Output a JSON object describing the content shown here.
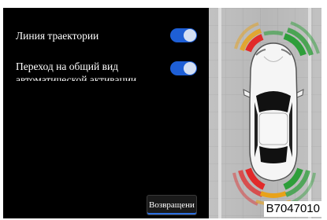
{
  "settings": {
    "trajectory_label": "Линия траектории",
    "trajectory_on": true,
    "overview_label_line1": "Переход на общий вид",
    "overview_label_line2": "автоматической активации",
    "overview_on": true,
    "back_label": "Возвращени"
  },
  "colors": {
    "toggle_on": "#1e5fd6",
    "sensor_red": "#e12a2a",
    "sensor_yellow": "#e8a21a",
    "sensor_green": "#2e9e3a"
  },
  "watermark": {
    "code": "B7047010"
  }
}
